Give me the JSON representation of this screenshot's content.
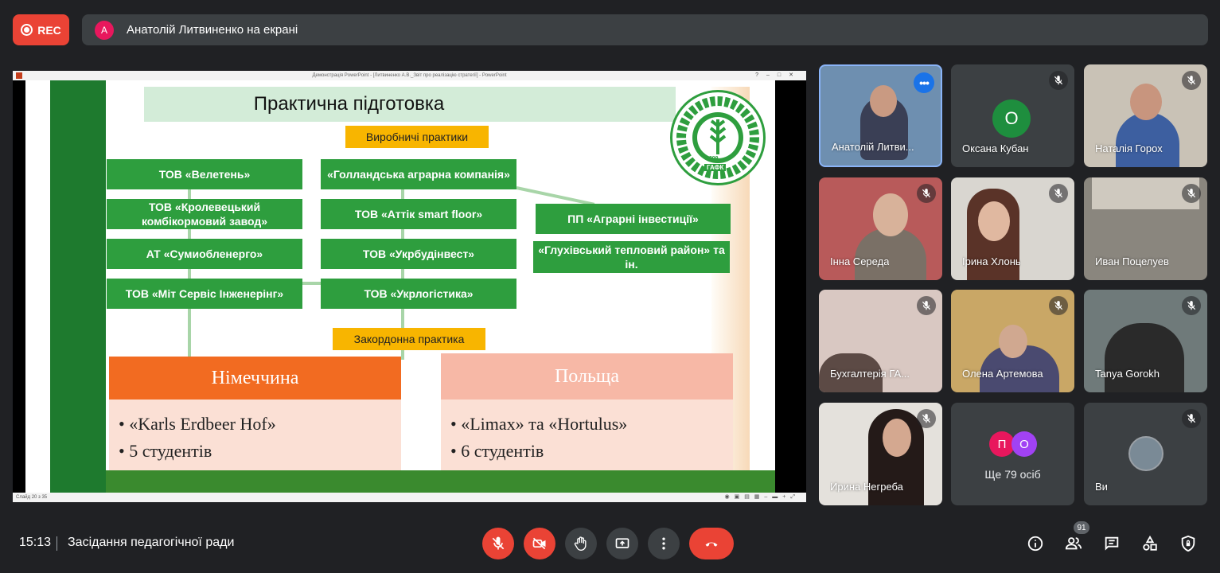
{
  "recording": {
    "label": "REC"
  },
  "presenter": {
    "initial": "А",
    "text": "Анатолій Литвиненко на екрані"
  },
  "ppt": {
    "window_title": "Демонстрація PowerPoint - [Литвиненко А.В._Звіт про реалізацію стратегії] - PowerPoint",
    "status": "Слайд 20 з 35"
  },
  "slide": {
    "title": "Практична підготовка",
    "label_production": "Виробничі практики",
    "label_abroad": "Закордонна практика",
    "logo_year": "1899",
    "logo_abbr": "ГАФК",
    "col1": [
      "ТОВ «Велетень»",
      "ТОВ «Кролевецький комбікормовий завод»",
      "АТ «Сумиобленерго»",
      "ТОВ  «Міт Сервіс Інженерінг»"
    ],
    "col2": [
      "«Голландська аграрна компанія»",
      "ТОВ «Аттік smart floor»",
      "ТОВ «Укрбудінвест»",
      "ТОВ «Укрлогістика»"
    ],
    "col3": [
      "ПП «Аграрні інвестиції»",
      "«Глухівський тепловий район» та ін."
    ],
    "germany": {
      "name": "Німеччина",
      "items": [
        "«Karls Erdbeer Hof»",
        "5 студентів"
      ]
    },
    "poland": {
      "name": "Польща",
      "items": [
        "«Limax» та «Hortulus»",
        "6 студентів"
      ]
    }
  },
  "participants": [
    {
      "name": "Анатолій Литви...",
      "mic": "on"
    },
    {
      "name": "Оксана Кубан",
      "initial": "О",
      "mic": "off"
    },
    {
      "name": "Наталія Горох",
      "mic": "off"
    },
    {
      "name": "Інна Середа",
      "mic": "off"
    },
    {
      "name": "Ірина Хлонь",
      "mic": "off"
    },
    {
      "name": "Иван Поцелуев",
      "mic": "off"
    },
    {
      "name": "Бухгалтерія ГА...",
      "mic": "off"
    },
    {
      "name": "Олена Артемова",
      "mic": "off"
    },
    {
      "name": "Tanya Gorokh",
      "mic": "off"
    },
    {
      "name": "Ирина Негреба",
      "mic": "off"
    },
    {
      "name": "Ще 79 осіб",
      "initials": [
        "П",
        "О"
      ]
    },
    {
      "name": "Ви",
      "mic": "off"
    }
  ],
  "bottom": {
    "time": "15:13",
    "meeting_title": "Засідання педагогічної ради",
    "people_count": "91"
  },
  "colors": {
    "rec": "#ea4335",
    "slide_green": "#2e9e3e",
    "label_yellow": "#f8b500",
    "germany_orange": "#f26b21",
    "poland_peach": "#f7b8a6",
    "more_blue": "#1a73e8"
  }
}
